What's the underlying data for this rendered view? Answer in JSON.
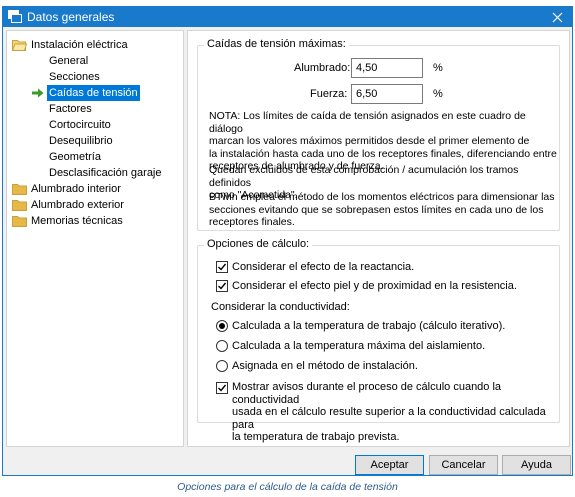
{
  "window": {
    "title": "Datos generales"
  },
  "tree": {
    "items": [
      {
        "label": "Instalación eléctrica",
        "expanded": true
      },
      {
        "label": "General"
      },
      {
        "label": "Secciones"
      },
      {
        "label": "Caídas de tensión",
        "selected": true
      },
      {
        "label": "Factores"
      },
      {
        "label": "Cortocircuito"
      },
      {
        "label": "Desequilibrio"
      },
      {
        "label": "Geometría"
      },
      {
        "label": "Desclasificación garaje"
      },
      {
        "label": "Alumbrado interior"
      },
      {
        "label": "Alumbrado exterior"
      },
      {
        "label": "Memorias técnicas"
      }
    ]
  },
  "voltage_drop": {
    "legend": "Caídas de tensión máximas:",
    "lighting_label": "Alumbrado:",
    "lighting_value": "4,50",
    "power_label": "Fuerza:",
    "power_value": "6,50",
    "unit": "%",
    "note_lines": [
      "NOTA: Los límites de caída de tensión asignados en este cuadro de diálogo",
      "marcan los valores máximos permitidos desde el primer elemento de",
      "la instalación hasta cada uno de los receptores finales, diferenciando entre",
      "receptores de alumbrado y de fuerza."
    ],
    "excluded_lines": [
      "Quedan excluidos de esta comprobación / acumulación los tramos definidos",
      "como \"Acometida\"."
    ],
    "method_lines": [
      "BTwin emplea el método de los momentos eléctricos para dimensionar las",
      "secciones evitando que se sobrepasen estos límites en cada uno de los",
      "receptores finales."
    ]
  },
  "calc_options": {
    "legend": "Opciones de cálculo:",
    "reactance_label": "Considerar el efecto de la reactancia.",
    "reactance_checked": true,
    "skin_label": "Considerar el efecto piel y de proximidad en la resistencia.",
    "skin_checked": true,
    "conductivity_label": "Considerar la conductividad:",
    "radio_options": [
      "Calculada a la temperatura de trabajo (cálculo iterativo).",
      "Calculada a la temperatura máxima del aislamiento.",
      "Asignada en el método de instalación."
    ],
    "radio_selected": 0,
    "warning_lines": [
      "Mostrar avisos durante el proceso de cálculo cuando la conductividad",
      "usada en el cálculo resulte superior a la conductividad calculada para",
      "la temperatura de trabajo prevista."
    ],
    "warning_checked": true
  },
  "buttons": {
    "accept": "Aceptar",
    "cancel": "Cancelar",
    "help": "Ayuda"
  },
  "caption": "Opciones para el cálculo de la caída de tensión",
  "colors": {
    "titlebar": "#1979ca",
    "selection": "#0078d7",
    "folder": "#e8b847",
    "arrow": "#3a9a2a"
  }
}
